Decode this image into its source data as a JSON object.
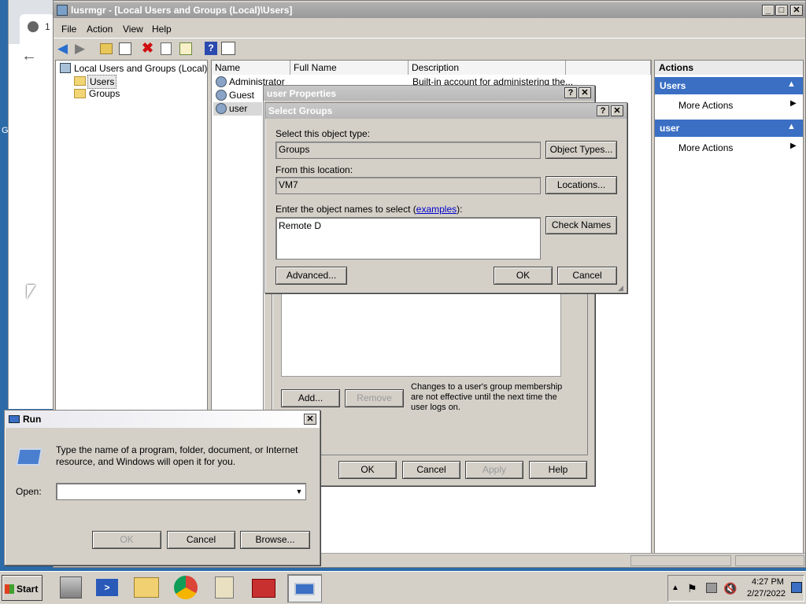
{
  "mmc": {
    "title": "lusrmgr - [Local Users and Groups (Local)\\Users]",
    "menu": [
      "File",
      "Action",
      "View",
      "Help"
    ],
    "tree": {
      "root": "Local Users and Groups (Local)",
      "items": [
        "Users",
        "Groups"
      ]
    },
    "columns": [
      "Name",
      "Full Name",
      "Description"
    ],
    "rows": [
      {
        "name": "Administrator",
        "description": "Built-in account for administering the..."
      },
      {
        "name": "Guest",
        "description": ""
      },
      {
        "name": "user",
        "description": ""
      }
    ],
    "actions": {
      "header": "Actions",
      "sections": [
        {
          "title": "Users",
          "items": [
            "More Actions"
          ]
        },
        {
          "title": "user",
          "items": [
            "More Actions"
          ]
        }
      ]
    }
  },
  "user_properties": {
    "title": "user Properties",
    "help_char": "?",
    "buttons": {
      "add": "Add...",
      "remove": "Remove",
      "ok": "OK",
      "cancel": "Cancel",
      "apply": "Apply",
      "help": "Help"
    },
    "note": "Changes to a user's group membership are not effective until the next time the user logs on."
  },
  "select_groups": {
    "title": "Select Groups",
    "object_type_label": "Select this object type:",
    "object_type_value": "Groups",
    "object_types_button": "Object Types...",
    "location_label": "From this location:",
    "location_value": "VM7",
    "locations_button": "Locations...",
    "names_label_prefix": "Enter the object names to select (",
    "names_label_link": "examples",
    "names_label_suffix": "):",
    "names_value": "Remote D",
    "check_names_button": "Check Names",
    "advanced_button": "Advanced...",
    "ok_button": "OK",
    "cancel_button": "Cancel"
  },
  "run_dialog": {
    "title": "Run",
    "description": "Type the name of a program, folder, document, or Internet resource, and Windows will open it for you.",
    "open_label": "Open:",
    "open_value": "",
    "ok_button": "OK",
    "cancel_button": "Cancel",
    "browse_button": "Browse..."
  },
  "browser_behind": {
    "tab_char": "1",
    "side_letter": "G"
  },
  "taskbar": {
    "start_label": "Start",
    "time": "4:27 PM",
    "date": "2/27/2022"
  },
  "colors": {
    "desktop": "#2d6aa8",
    "actions_header": "#3a6fc4",
    "dialog_face": "#d4d0c8",
    "link": "#0000cc"
  }
}
